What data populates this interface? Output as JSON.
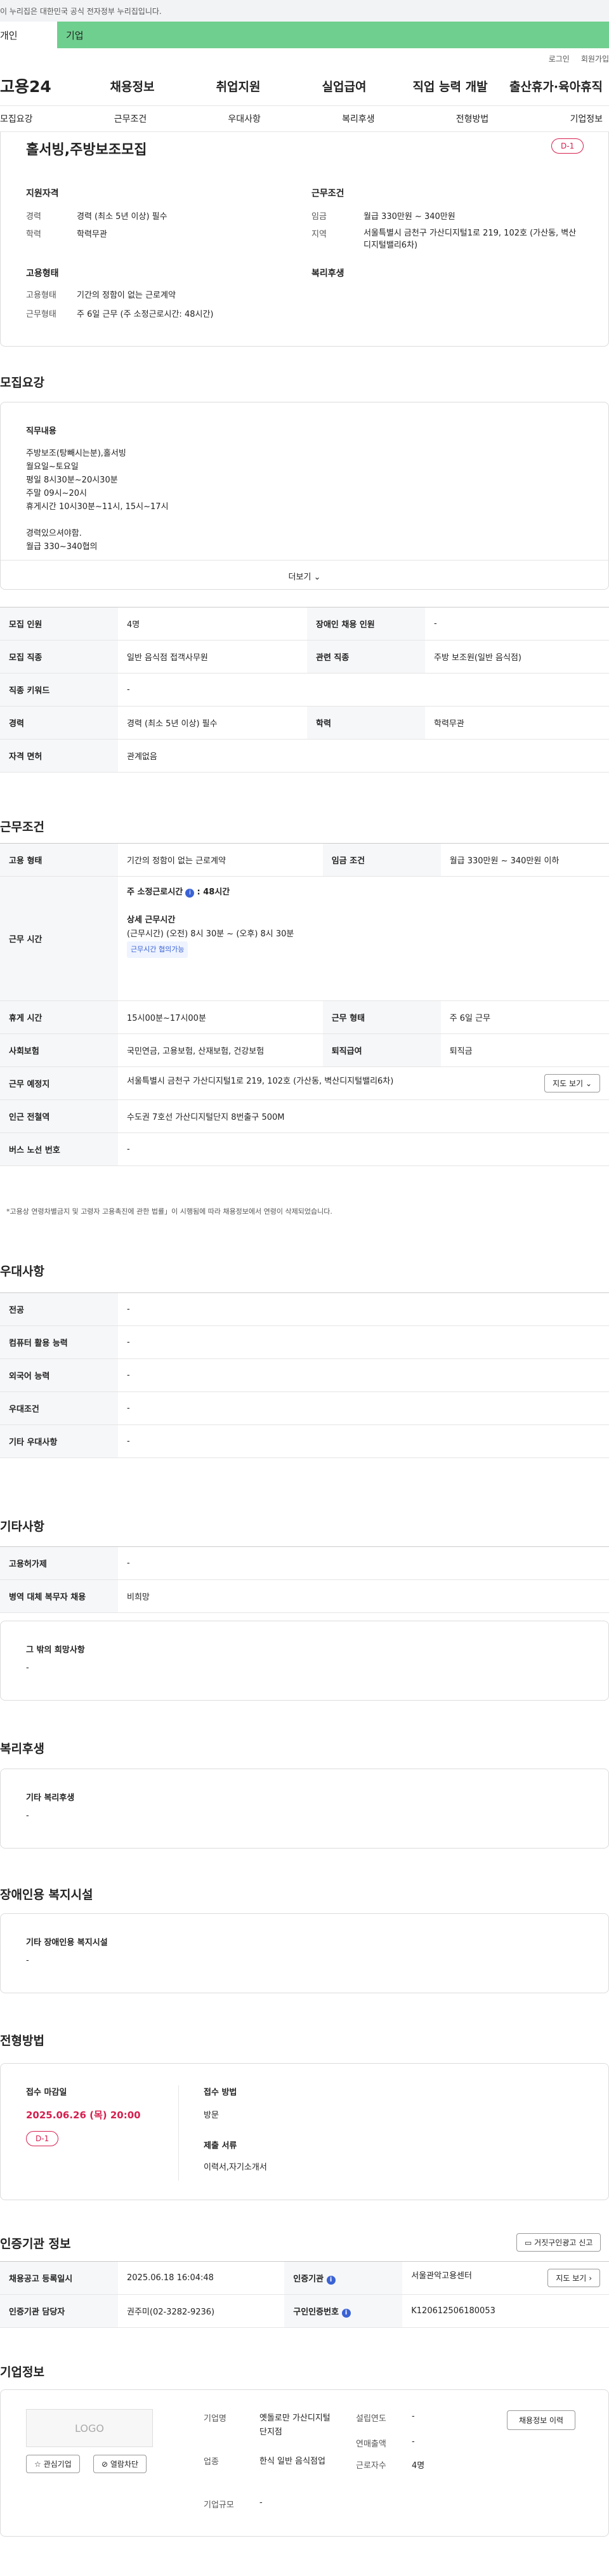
{
  "gov_banner": "이 누리집은 대한민국 공식 전자정부 누리집입니다.",
  "top_tabs": {
    "individual": "개인",
    "company": "기업"
  },
  "util": {
    "login": "로그인",
    "join": "회원가입"
  },
  "logo": "고용24",
  "gnb": [
    "채용정보",
    "취업지원",
    "실업급여",
    "직업 능력 개발",
    "출산휴가·육아휴직"
  ],
  "lnb": [
    "모집요강",
    "근무조건",
    "우대사항",
    "복리후생",
    "전형방법",
    "기업정보"
  ],
  "job": {
    "title": "홀서빙,주방보조모집",
    "dday": "D-1"
  },
  "summary": {
    "qual_title": "지원자격",
    "cond_title": "근무조건",
    "career_label": "경력",
    "career": "경력 (최소 5년 이상) 필수",
    "edu_label": "학력",
    "edu": "학력무관",
    "wage_label": "임금",
    "wage": "월급 330만원 ~ 340만원",
    "area_label": "지역",
    "area": "서울특별시 금천구 가산디지털1로 219, 102호 (가산동, 벽산디지털밸리6차)",
    "emp_title": "고용형태",
    "welfare_title": "복리후생",
    "emptype_label": "고용형태",
    "emptype": "기간의 정함이 없는 근로계약",
    "worktype_label": "근무형태",
    "worktype": "주 6일 근무 (주 소정근로시간: 48시간)"
  },
  "recruit": {
    "heading": "모집요강",
    "duty_title": "직무내용",
    "duty_lines": [
      "주방보조(탕빼시는분),홀서빙",
      "월요일~토요일",
      "평일 8시30분~20시30분",
      "주말 09시~20시",
      "휴게시간 10시30분~11시, 15시~17시",
      "",
      "경력있으셔야함.",
      "월급 330~340협의"
    ],
    "more": "더보기",
    "rows": [
      [
        "모집 인원",
        "4명",
        "장애인 채용 인원",
        "-"
      ],
      [
        "모집 직종",
        "일반 음식점 접객사무원",
        "관련 직종",
        "주방 보조원(일반 음식점)"
      ],
      [
        "직종 키워드",
        "-",
        "",
        ""
      ],
      [
        "경력",
        "경력 (최소 5년 이상) 필수",
        "학력",
        "학력무관"
      ],
      [
        "자격 면허",
        "관계없음",
        "",
        ""
      ]
    ]
  },
  "work": {
    "heading": "근무조건",
    "emp_label": "고용 형태",
    "emp": "기간의 정함이 없는 근로계약",
    "wage_label": "임금 조건",
    "wage": "월급 330만원 ~ 340만원 이하",
    "hours_label": "근무 시간",
    "weekly": "주 소정근로시간",
    "weekly_val": ": 48시간",
    "detail_title": "상세 근무시간",
    "detail": "(근무시간) (오전) 8시 30분 ~ (오후) 8시 30분",
    "detail_tag": "근무시간 협의가능",
    "rest_label": "휴게 시간",
    "rest": "15시00분~17시00분",
    "form_label": "근무 형태",
    "form": "주 6일 근무",
    "ins_label": "사회보험",
    "ins": "국민연금, 고용보험, 산재보험, 건강보험",
    "sev_label": "퇴직급여",
    "sev": "퇴직금",
    "place_label": "근무 예정지",
    "place": "서울특별시 금천구 가산디지털1로 219, 102호 (가산동, 벽산디지털밸리6차)",
    "map": "지도 보기",
    "subway_label": "인근 전철역",
    "subway": "수도권 7호선 가산디지털단지 8번출구 500M",
    "bus_label": "버스 노선 번호",
    "bus": "-",
    "note": "*고용상 연령차별금지 및 고령자 고용촉진에 관한 법률」이 시행됨에 따라 채용정보에서 연령이 삭제되었습니다."
  },
  "pref": {
    "heading": "우대사항",
    "rows": [
      [
        "전공",
        "-"
      ],
      [
        "컴퓨터 활용 능력",
        "-"
      ],
      [
        "외국어 능력",
        "-"
      ],
      [
        "우대조건",
        "-"
      ],
      [
        "기타 우대사항",
        "-"
      ]
    ]
  },
  "etc": {
    "heading": "기타사항",
    "rows": [
      [
        "고용허가제",
        "-"
      ],
      [
        "병역 대체 복무자 채용",
        "비희망"
      ]
    ],
    "hope_title": "그 밖의 희망사항",
    "hope": "-"
  },
  "welfare": {
    "heading": "복리후생",
    "title": "기타 복리후생",
    "value": "-"
  },
  "disabled": {
    "heading": "장애인용 복지시설",
    "title": "기타 장애인용 복지시설",
    "value": "-"
  },
  "selection": {
    "heading": "전형방법",
    "deadline_title": "접수 마감일",
    "deadline": "2025.06.26 (목) 20:00",
    "dday": "D-1",
    "method_title": "접수 방법",
    "method": "방문",
    "docs_title": "제출 서류",
    "docs": "이력서,자기소개서"
  },
  "agency": {
    "heading": "인증기관 정보",
    "report": "거짓구인광고 신고",
    "rows": [
      [
        "채용공고 등록일시",
        "2025.06.18 16:04:48",
        "인증기관",
        "서울관악고용센터"
      ],
      [
        "인증기관 담당자",
        "권주미(02-3282-9236)",
        "구인인증번호",
        "K120612506180053"
      ]
    ],
    "map": "지도 보기"
  },
  "company": {
    "heading": "기업정보",
    "logo": "LOGO",
    "fav": "관심기업",
    "block": "열람차단",
    "name_label": "기업명",
    "name": "옛돌로만 가산디지털단지점",
    "found_label": "설립연도",
    "found": "-",
    "sales_label": "연매출액",
    "sales": "-",
    "ind_label": "업종",
    "ind": "한식 일반 음식점업",
    "emp_label": "근로자수",
    "emp": "4명",
    "scale_label": "기업규모",
    "scale": "-",
    "jobs": "채용정보 이력"
  }
}
